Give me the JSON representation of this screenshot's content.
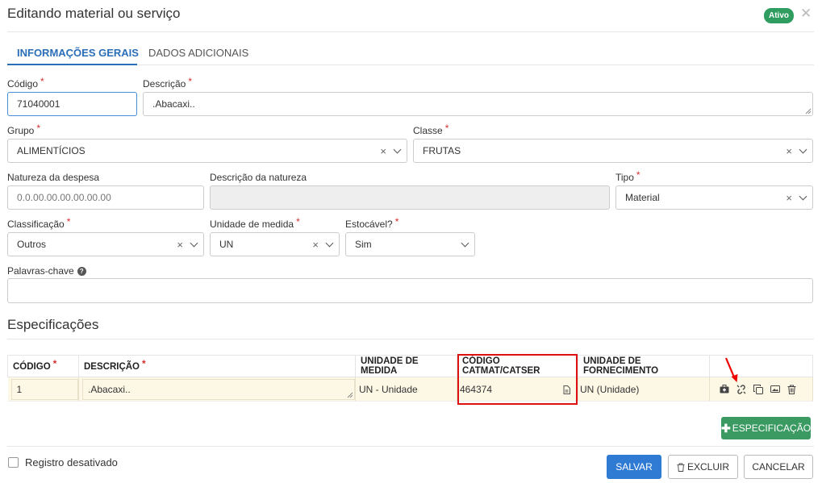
{
  "header": {
    "title": "Editando material ou serviço",
    "status_badge": "Ativo"
  },
  "tabs": [
    {
      "label": "INFORMAÇÕES GERAIS",
      "active": true
    },
    {
      "label": "DADOS ADICIONAIS",
      "active": false
    }
  ],
  "form": {
    "codigo": {
      "label": "Código",
      "value": "71040001"
    },
    "descricao": {
      "label": "Descrição",
      "value": ".Abacaxi.."
    },
    "grupo": {
      "label": "Grupo",
      "value": "ALIMENTÍCIOS"
    },
    "classe": {
      "label": "Classe",
      "value": "FRUTAS"
    },
    "natureza": {
      "label": "Natureza da despesa",
      "placeholder": "0.0.00.00.00.00.00.00"
    },
    "desc_natureza": {
      "label": "Descrição da natureza",
      "value": ""
    },
    "tipo": {
      "label": "Tipo",
      "value": "Material"
    },
    "classificacao": {
      "label": "Classificação",
      "value": "Outros"
    },
    "unidade": {
      "label": "Unidade de medida",
      "value": "UN"
    },
    "estocavel": {
      "label": "Estocável?",
      "value": "Sim"
    },
    "palavras": {
      "label": "Palavras-chave",
      "value": ""
    }
  },
  "especificacoes": {
    "title": "Especificações",
    "columns": [
      "CÓDIGO",
      "DESCRIÇÃO",
      "UNIDADE DE MEDIDA",
      "CÓDIGO CATMAT/CATSER",
      "UNIDADE DE FORNECIMENTO"
    ],
    "rows": [
      {
        "codigo": "1",
        "descricao": ".Abacaxi..",
        "unidade": "UN - Unidade",
        "catmat": "464374",
        "fornecimento": "UN (Unidade)"
      }
    ],
    "add_button": "ESPECIFICAÇÃO"
  },
  "footer": {
    "checkbox_label": "Registro desativado",
    "save": "SALVAR",
    "delete": "EXCLUIR",
    "cancel": "CANCELAR"
  },
  "colors": {
    "accent": "#2a6eb8",
    "success": "#3a9a62",
    "highlight": "#d11111"
  }
}
